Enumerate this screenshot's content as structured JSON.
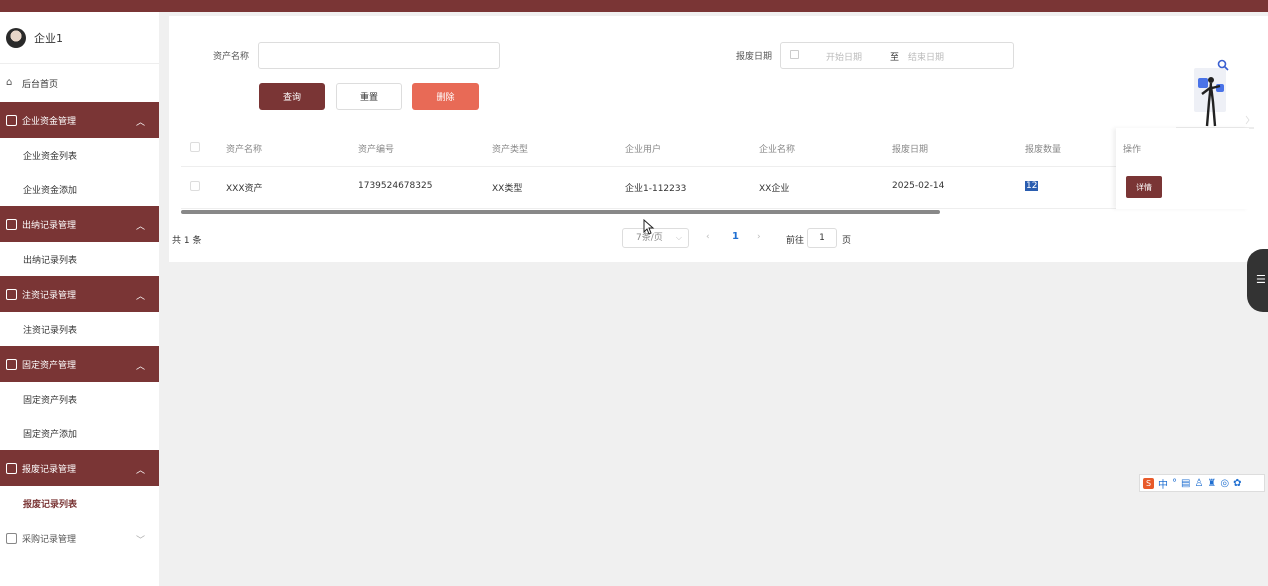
{
  "user": {
    "name": "企业1"
  },
  "nav": {
    "home": "后台首页",
    "groups": [
      {
        "label": "企业资金管理",
        "expanded": true,
        "items": [
          "企业资金列表",
          "企业资金添加"
        ]
      },
      {
        "label": "出纳记录管理",
        "expanded": true,
        "items": [
          "出纳记录列表"
        ]
      },
      {
        "label": "注资记录管理",
        "expanded": true,
        "items": [
          "注资记录列表"
        ]
      },
      {
        "label": "固定资产管理",
        "expanded": true,
        "items": [
          "固定资产列表",
          "固定资产添加"
        ]
      },
      {
        "label": "报废记录管理",
        "expanded": true,
        "items": [
          "报废记录列表"
        ],
        "active_item": "报废记录列表"
      },
      {
        "label": "采购记录管理",
        "expanded": false,
        "items": []
      }
    ]
  },
  "filter": {
    "asset_name_label": "资产名称",
    "asset_name_value": "",
    "scrap_date_label": "报废日期",
    "start_placeholder": "开始日期",
    "range_sep": "至",
    "end_placeholder": "结束日期"
  },
  "buttons": {
    "query": "查询",
    "reset": "重置",
    "delete": "删除",
    "detail": "详情"
  },
  "table": {
    "headers": [
      "资产名称",
      "资产编号",
      "资产类型",
      "企业用户",
      "企业名称",
      "报废日期",
      "报废数量",
      "操作"
    ],
    "rows": [
      {
        "asset_name": "XXX资产",
        "asset_no": "1739524678325",
        "asset_type": "XX类型",
        "company_user": "企业1-112233",
        "company_name": "XX企业",
        "scrap_date": "2025-02-14",
        "scrap_qty": "12"
      }
    ]
  },
  "pagination": {
    "total": "共 1 条",
    "page_size": "7条/页",
    "current_page": "1",
    "goto_label": "前往",
    "goto_value": "1",
    "goto_unit": "页",
    "prev": "‹",
    "next": "›"
  },
  "ime": {
    "logo": "S",
    "mode": "中"
  },
  "colors": {
    "brand": "#7a3535",
    "danger": "#e86a56",
    "link": "#1f6fd1"
  }
}
